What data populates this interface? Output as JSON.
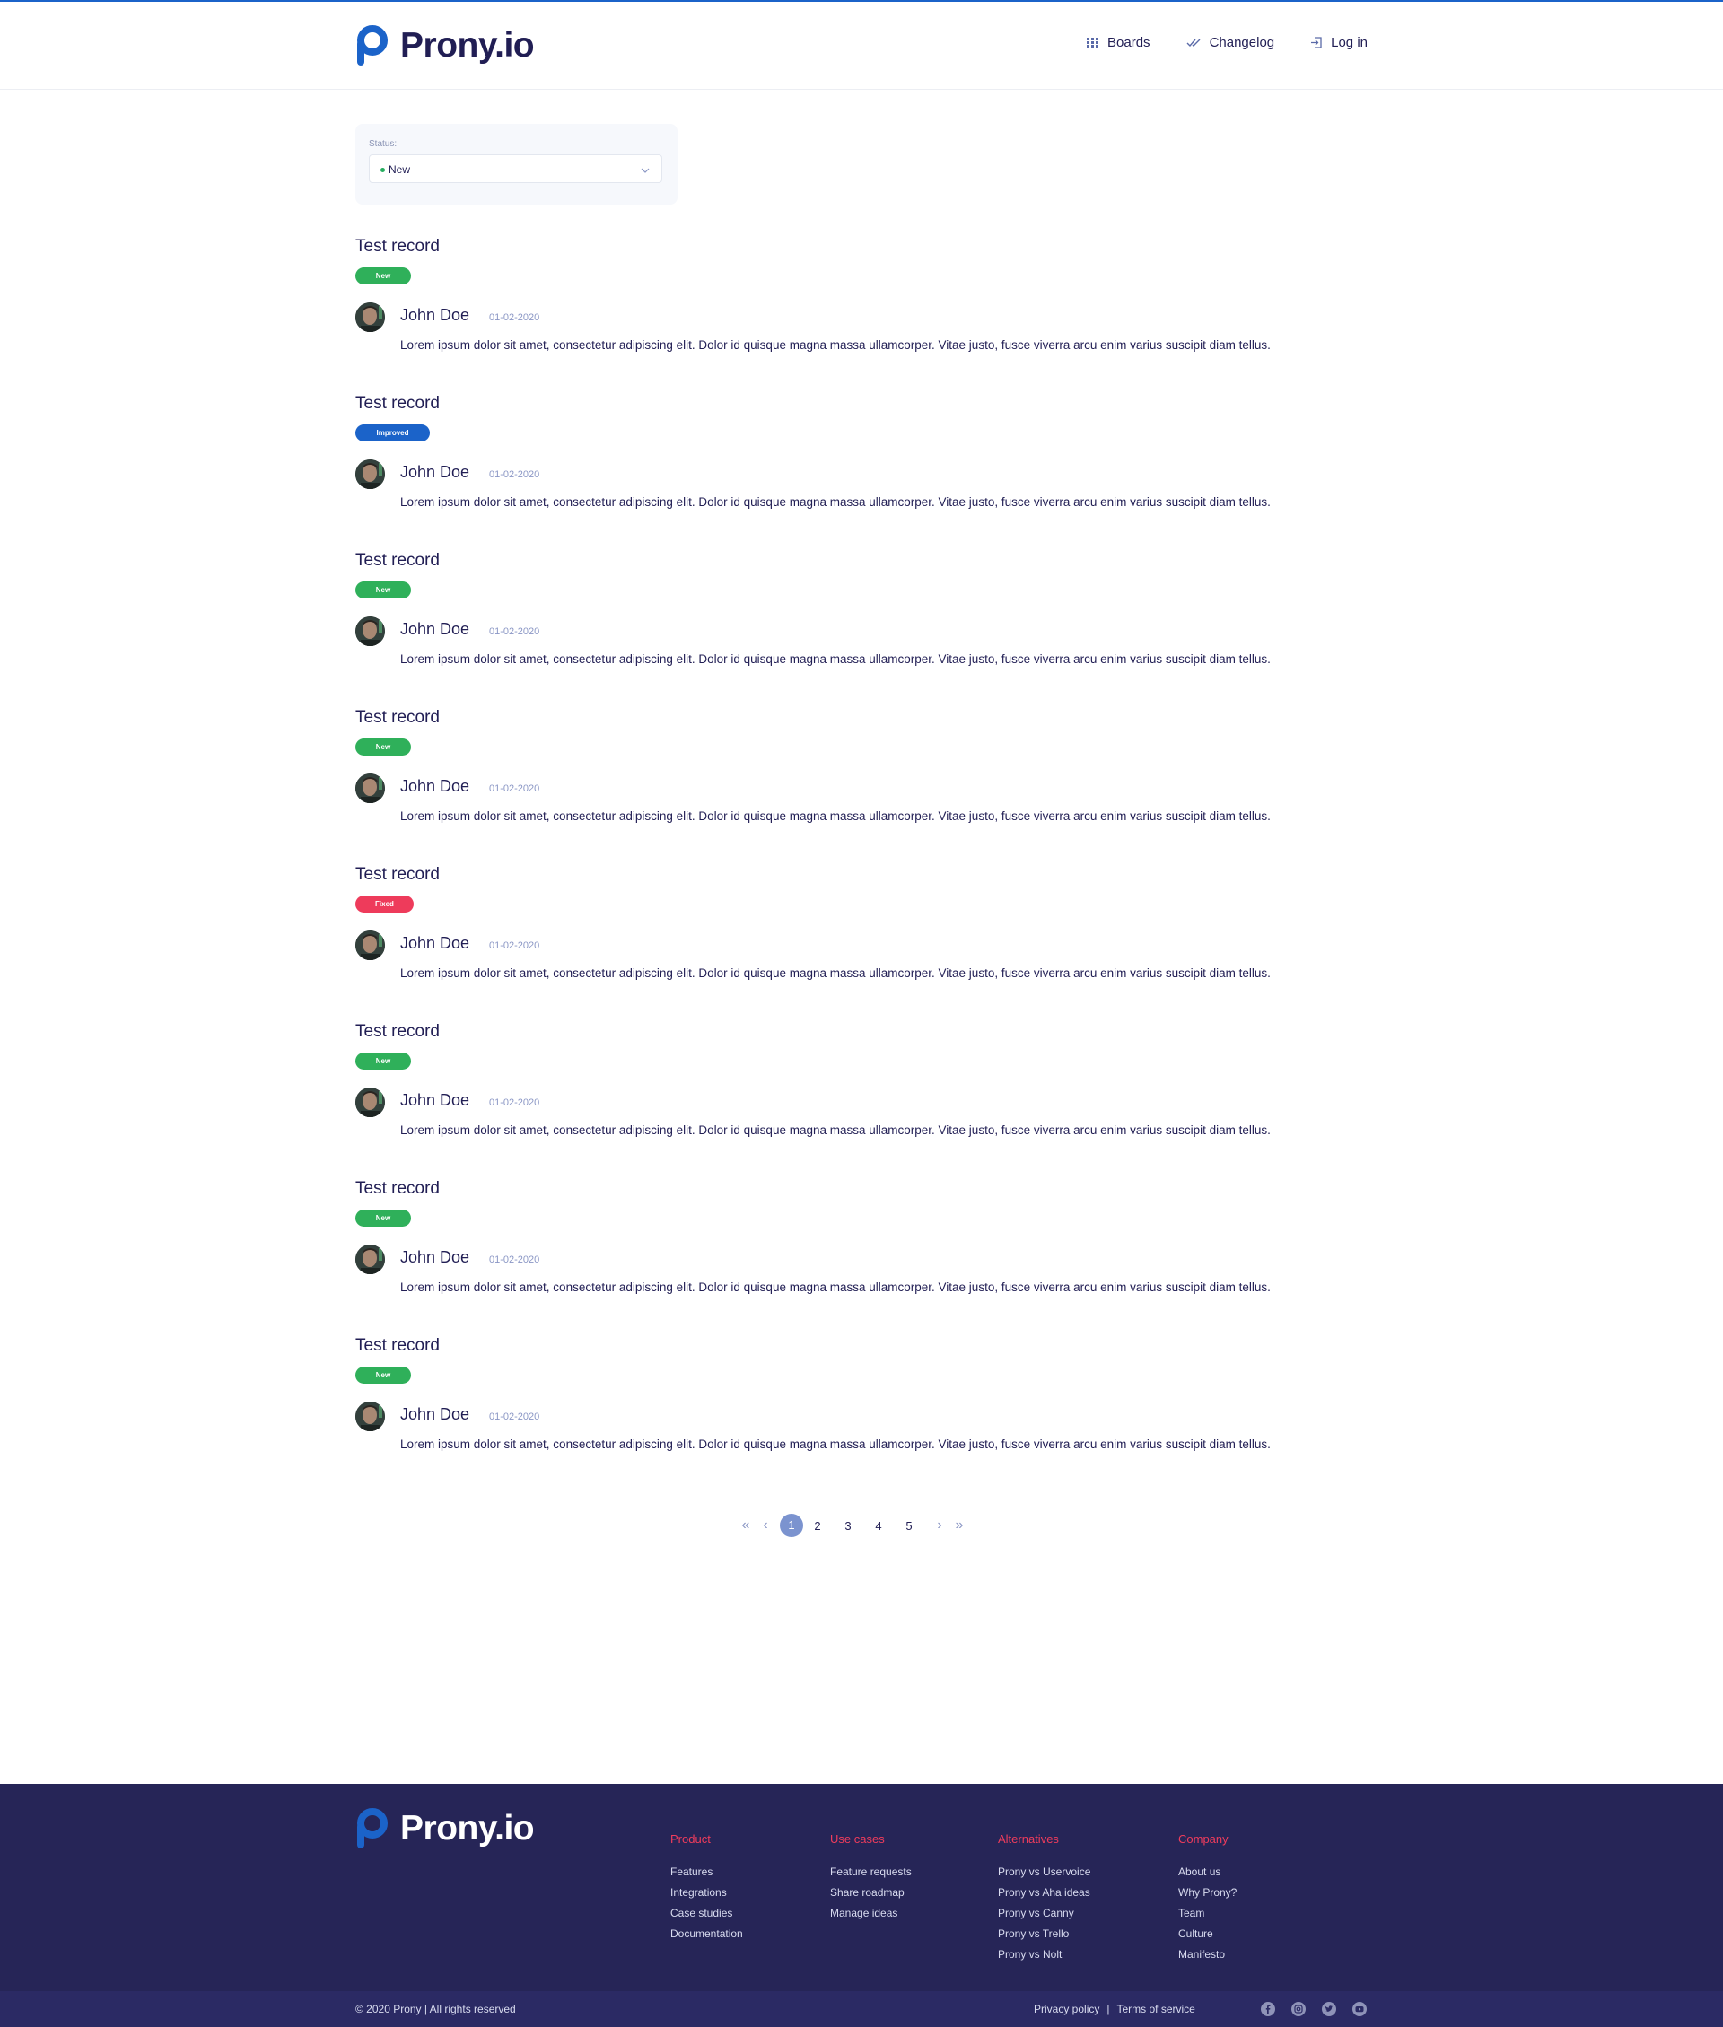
{
  "brand": {
    "name": "Prony.io",
    "color": "#1b63c9"
  },
  "nav": {
    "boards": "Boards",
    "changelog": "Changelog",
    "login": "Log in"
  },
  "filter": {
    "label": "Status:",
    "value": "New",
    "dot_color": "#27ae60"
  },
  "records": [
    {
      "title": "Test record",
      "status": "New",
      "status_class": "new",
      "author": "John Doe",
      "date": "01-02-2020",
      "text": "Lorem ipsum dolor sit amet, consectetur adipiscing elit. Dolor id quisque magna massa ullamcorper. Vitae justo, fusce viverra arcu enim varius suscipit diam tellus."
    },
    {
      "title": "Test record",
      "status": "Improved",
      "status_class": "improved",
      "author": "John Doe",
      "date": "01-02-2020",
      "text": "Lorem ipsum dolor sit amet, consectetur adipiscing elit. Dolor id quisque magna massa ullamcorper. Vitae justo, fusce viverra arcu enim varius suscipit diam tellus."
    },
    {
      "title": "Test record",
      "status": "New",
      "status_class": "new",
      "author": "John Doe",
      "date": "01-02-2020",
      "text": "Lorem ipsum dolor sit amet, consectetur adipiscing elit. Dolor id quisque magna massa ullamcorper. Vitae justo, fusce viverra arcu enim varius suscipit diam tellus."
    },
    {
      "title": "Test record",
      "status": "New",
      "status_class": "new",
      "author": "John Doe",
      "date": "01-02-2020",
      "text": "Lorem ipsum dolor sit amet, consectetur adipiscing elit. Dolor id quisque magna massa ullamcorper. Vitae justo, fusce viverra arcu enim varius suscipit diam tellus."
    },
    {
      "title": "Test record",
      "status": "Fixed",
      "status_class": "fixed",
      "author": "John Doe",
      "date": "01-02-2020",
      "text": "Lorem ipsum dolor sit amet, consectetur adipiscing elit. Dolor id quisque magna massa ullamcorper. Vitae justo, fusce viverra arcu enim varius suscipit diam tellus."
    },
    {
      "title": "Test record",
      "status": "New",
      "status_class": "new",
      "author": "John Doe",
      "date": "01-02-2020",
      "text": "Lorem ipsum dolor sit amet, consectetur adipiscing elit. Dolor id quisque magna massa ullamcorper. Vitae justo, fusce viverra arcu enim varius suscipit diam tellus."
    },
    {
      "title": "Test record",
      "status": "New",
      "status_class": "new",
      "author": "John Doe",
      "date": "01-02-2020",
      "text": "Lorem ipsum dolor sit amet, consectetur adipiscing elit. Dolor id quisque magna massa ullamcorper. Vitae justo, fusce viverra arcu enim varius suscipit diam tellus."
    },
    {
      "title": "Test record",
      "status": "New",
      "status_class": "new",
      "author": "John Doe",
      "date": "01-02-2020",
      "text": "Lorem ipsum dolor sit amet, consectetur adipiscing elit. Dolor id quisque magna massa ullamcorper. Vitae justo, fusce viverra arcu enim varius suscipit diam tellus."
    }
  ],
  "pagination": {
    "first": "«",
    "prev": "‹",
    "next": "›",
    "last": "»",
    "pages": [
      "1",
      "2",
      "3",
      "4",
      "5"
    ],
    "current": "1"
  },
  "footer": {
    "columns": [
      {
        "title": "Product",
        "links": [
          "Features",
          "Integrations",
          "Case studies",
          "Documentation"
        ]
      },
      {
        "title": "Use cases",
        "links": [
          "Feature requests",
          "Share roadmap",
          "Manage ideas"
        ]
      },
      {
        "title": "Alternatives",
        "links": [
          "Prony vs Uservoice",
          "Prony vs Aha ideas",
          "Prony vs Canny",
          "Prony vs Trello",
          "Prony vs Nolt"
        ]
      },
      {
        "title": "Company",
        "links": [
          "About us",
          "Why Prony?",
          "Team",
          "Culture",
          "Manifesto"
        ]
      }
    ],
    "copyright": "© 2020 Prony  |  All rights reserved",
    "privacy": "Privacy policy",
    "separator": "|",
    "terms": "Terms of service",
    "socials": [
      "facebook-icon",
      "instagram-icon",
      "twitter-icon",
      "youtube-icon"
    ]
  }
}
